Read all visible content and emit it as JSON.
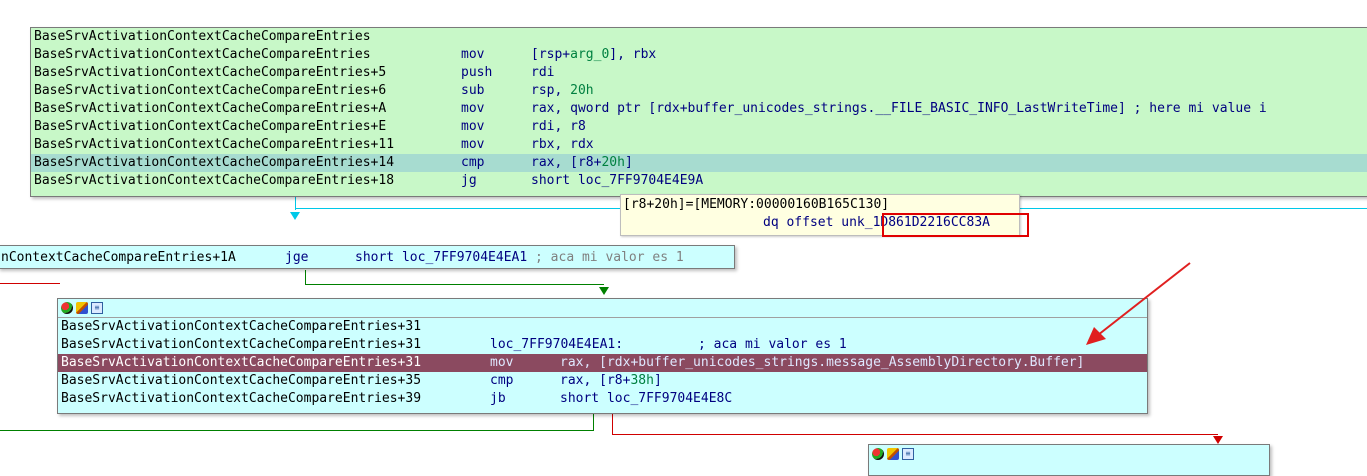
{
  "block1": {
    "rows": [
      {
        "addr": "BaseSrvActivationContextCacheCompareEntries",
        "mn": "",
        "ops": []
      },
      {
        "addr": "BaseSrvActivationContextCacheCompareEntries",
        "mn": "mov",
        "ops": [
          {
            "t": "[rsp+",
            "c": "op"
          },
          {
            "t": "arg_0",
            "c": "n"
          },
          {
            "t": "], rbx",
            "c": "op"
          }
        ]
      },
      {
        "addr": "BaseSrvActivationContextCacheCompareEntries+5",
        "mn": "push",
        "ops": [
          {
            "t": "rdi",
            "c": "op"
          }
        ]
      },
      {
        "addr": "BaseSrvActivationContextCacheCompareEntries+6",
        "mn": "sub",
        "ops": [
          {
            "t": "rsp, ",
            "c": "op"
          },
          {
            "t": "20h",
            "c": "n"
          }
        ]
      },
      {
        "addr": "BaseSrvActivationContextCacheCompareEntries+A",
        "mn": "mov",
        "ops": [
          {
            "t": "rax, qword ptr [rdx+buffer_unicodes_strings.__FILE_BASIC_INFO_LastWriteTime] ; here mi value i",
            "c": "op"
          }
        ]
      },
      {
        "addr": "BaseSrvActivationContextCacheCompareEntries+E",
        "mn": "mov",
        "ops": [
          {
            "t": "rdi, r8",
            "c": "op"
          }
        ]
      },
      {
        "addr": "BaseSrvActivationContextCacheCompareEntries+11",
        "mn": "mov",
        "ops": [
          {
            "t": "rbx, rdx",
            "c": "op"
          }
        ]
      },
      {
        "addr": "BaseSrvActivationContextCacheCompareEntries+14",
        "mn": "cmp",
        "ops": [
          {
            "t": "rax, [r8+",
            "c": "op"
          },
          {
            "t": "20h",
            "c": "n"
          },
          {
            "t": "]",
            "c": "op"
          }
        ]
      },
      {
        "addr": "BaseSrvActivationContextCacheCompareEntries+18",
        "mn": "jg",
        "ops": [
          {
            "t": "short loc_7FF9704E4E9A",
            "c": "op"
          }
        ]
      }
    ]
  },
  "tooltip": {
    "line1": "[r8+20h]=[MEMORY:00000160B165C130]",
    "line2_prefix": "dq offset unk_",
    "line2_value": "1D861D2216CC83A"
  },
  "block2": {
    "addr": "nContextCacheCompareEntries+1A",
    "mn": "jge",
    "ops": [
      {
        "t": "short loc_7FF9704E4EA1 ",
        "c": "op"
      },
      {
        "t": "; aca mi valor es 1",
        "c": "cm"
      }
    ]
  },
  "block3": {
    "rows": [
      {
        "addr": "BaseSrvActivationContextCacheCompareEntries+31",
        "mn": "",
        "ops": []
      },
      {
        "addr": "BaseSrvActivationContextCacheCompareEntries+31",
        "mn": "loc_7FF9704E4EA1:",
        "ops": [
          {
            "t": "; aca mi valor es 1",
            "c": "op"
          }
        ]
      },
      {
        "addr": "BaseSrvActivationContextCacheCompareEntries+31",
        "mn": "mov",
        "ops": [
          {
            "t": "rax, [rdx+buffer_unicodes_strings.message_AssemblyDirectory.Buffer]",
            "c": "op"
          }
        ]
      },
      {
        "addr": "BaseSrvActivationContextCacheCompareEntries+35",
        "mn": "cmp",
        "ops": [
          {
            "t": "rax, [r8+",
            "c": "op"
          },
          {
            "t": "38h",
            "c": "n"
          },
          {
            "t": "]",
            "c": "op"
          }
        ]
      },
      {
        "addr": "BaseSrvActivationContextCacheCompareEntries+39",
        "mn": "jb",
        "ops": [
          {
            "t": "short loc_7FF9704E4E8C",
            "c": "op"
          }
        ]
      }
    ]
  },
  "icons": [
    "graph-overview-icon",
    "edit-node-icon",
    "xrefs-icon"
  ],
  "colors": {
    "block1_bg": "#c8f8c8",
    "block1_selected": "#a7dcd0",
    "block_bg": "#ccffff",
    "selected_dark": "#8b4a60",
    "tooltip_bg": "#ffffe1",
    "highlight_box": "#e00000",
    "arrow_red": "#e02020",
    "edge_green": "#008000",
    "edge_red": "#d00000",
    "edge_cyan": "#00c8e8"
  }
}
